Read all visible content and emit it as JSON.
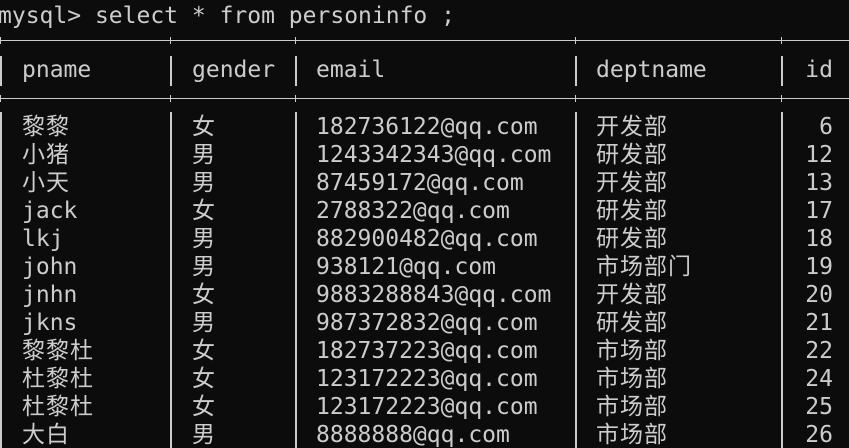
{
  "terminal": {
    "prompt": "mysql>",
    "command": " select * from personinfo ;"
  },
  "table": {
    "columns": [
      "pname",
      "gender",
      "email",
      "deptname",
      "id"
    ],
    "rows": [
      {
        "pname": "黎黎",
        "gender": "女",
        "email": "182736122@qq.com",
        "deptname": "开发部",
        "id": "6"
      },
      {
        "pname": "小猪",
        "gender": "男",
        "email": "1243342343@qq.com",
        "deptname": "研发部",
        "id": "12"
      },
      {
        "pname": "小天",
        "gender": "男",
        "email": "87459172@qq.com",
        "deptname": "开发部",
        "id": "13"
      },
      {
        "pname": "jack",
        "gender": "女",
        "email": "2788322@qq.com",
        "deptname": "研发部",
        "id": "17"
      },
      {
        "pname": "lkj",
        "gender": "男",
        "email": "882900482@qq.com",
        "deptname": "研发部",
        "id": "18"
      },
      {
        "pname": "john",
        "gender": "男",
        "email": "938121@qq.com",
        "deptname": "市场部门",
        "id": "19"
      },
      {
        "pname": "jnhn",
        "gender": "女",
        "email": "9883288843@qq.com",
        "deptname": "开发部",
        "id": "20"
      },
      {
        "pname": "jkns",
        "gender": "男",
        "email": "987372832@qq.com",
        "deptname": "研发部",
        "id": "21"
      },
      {
        "pname": "黎黎杜",
        "gender": "女",
        "email": "182737223@qq.com",
        "deptname": "市场部",
        "id": "22"
      },
      {
        "pname": "杜黎杜",
        "gender": "女",
        "email": "123172223@qq.com",
        "deptname": "市场部",
        "id": "24"
      },
      {
        "pname": "杜黎杜",
        "gender": "女",
        "email": "123172223@qq.com",
        "deptname": "市场部",
        "id": "25"
      },
      {
        "pname": "大白",
        "gender": "男",
        "email": "8888888@qq.com",
        "deptname": "市场部",
        "id": "26"
      }
    ]
  },
  "colors": {
    "background": "#0c0c0c",
    "text": "#cccccc"
  }
}
